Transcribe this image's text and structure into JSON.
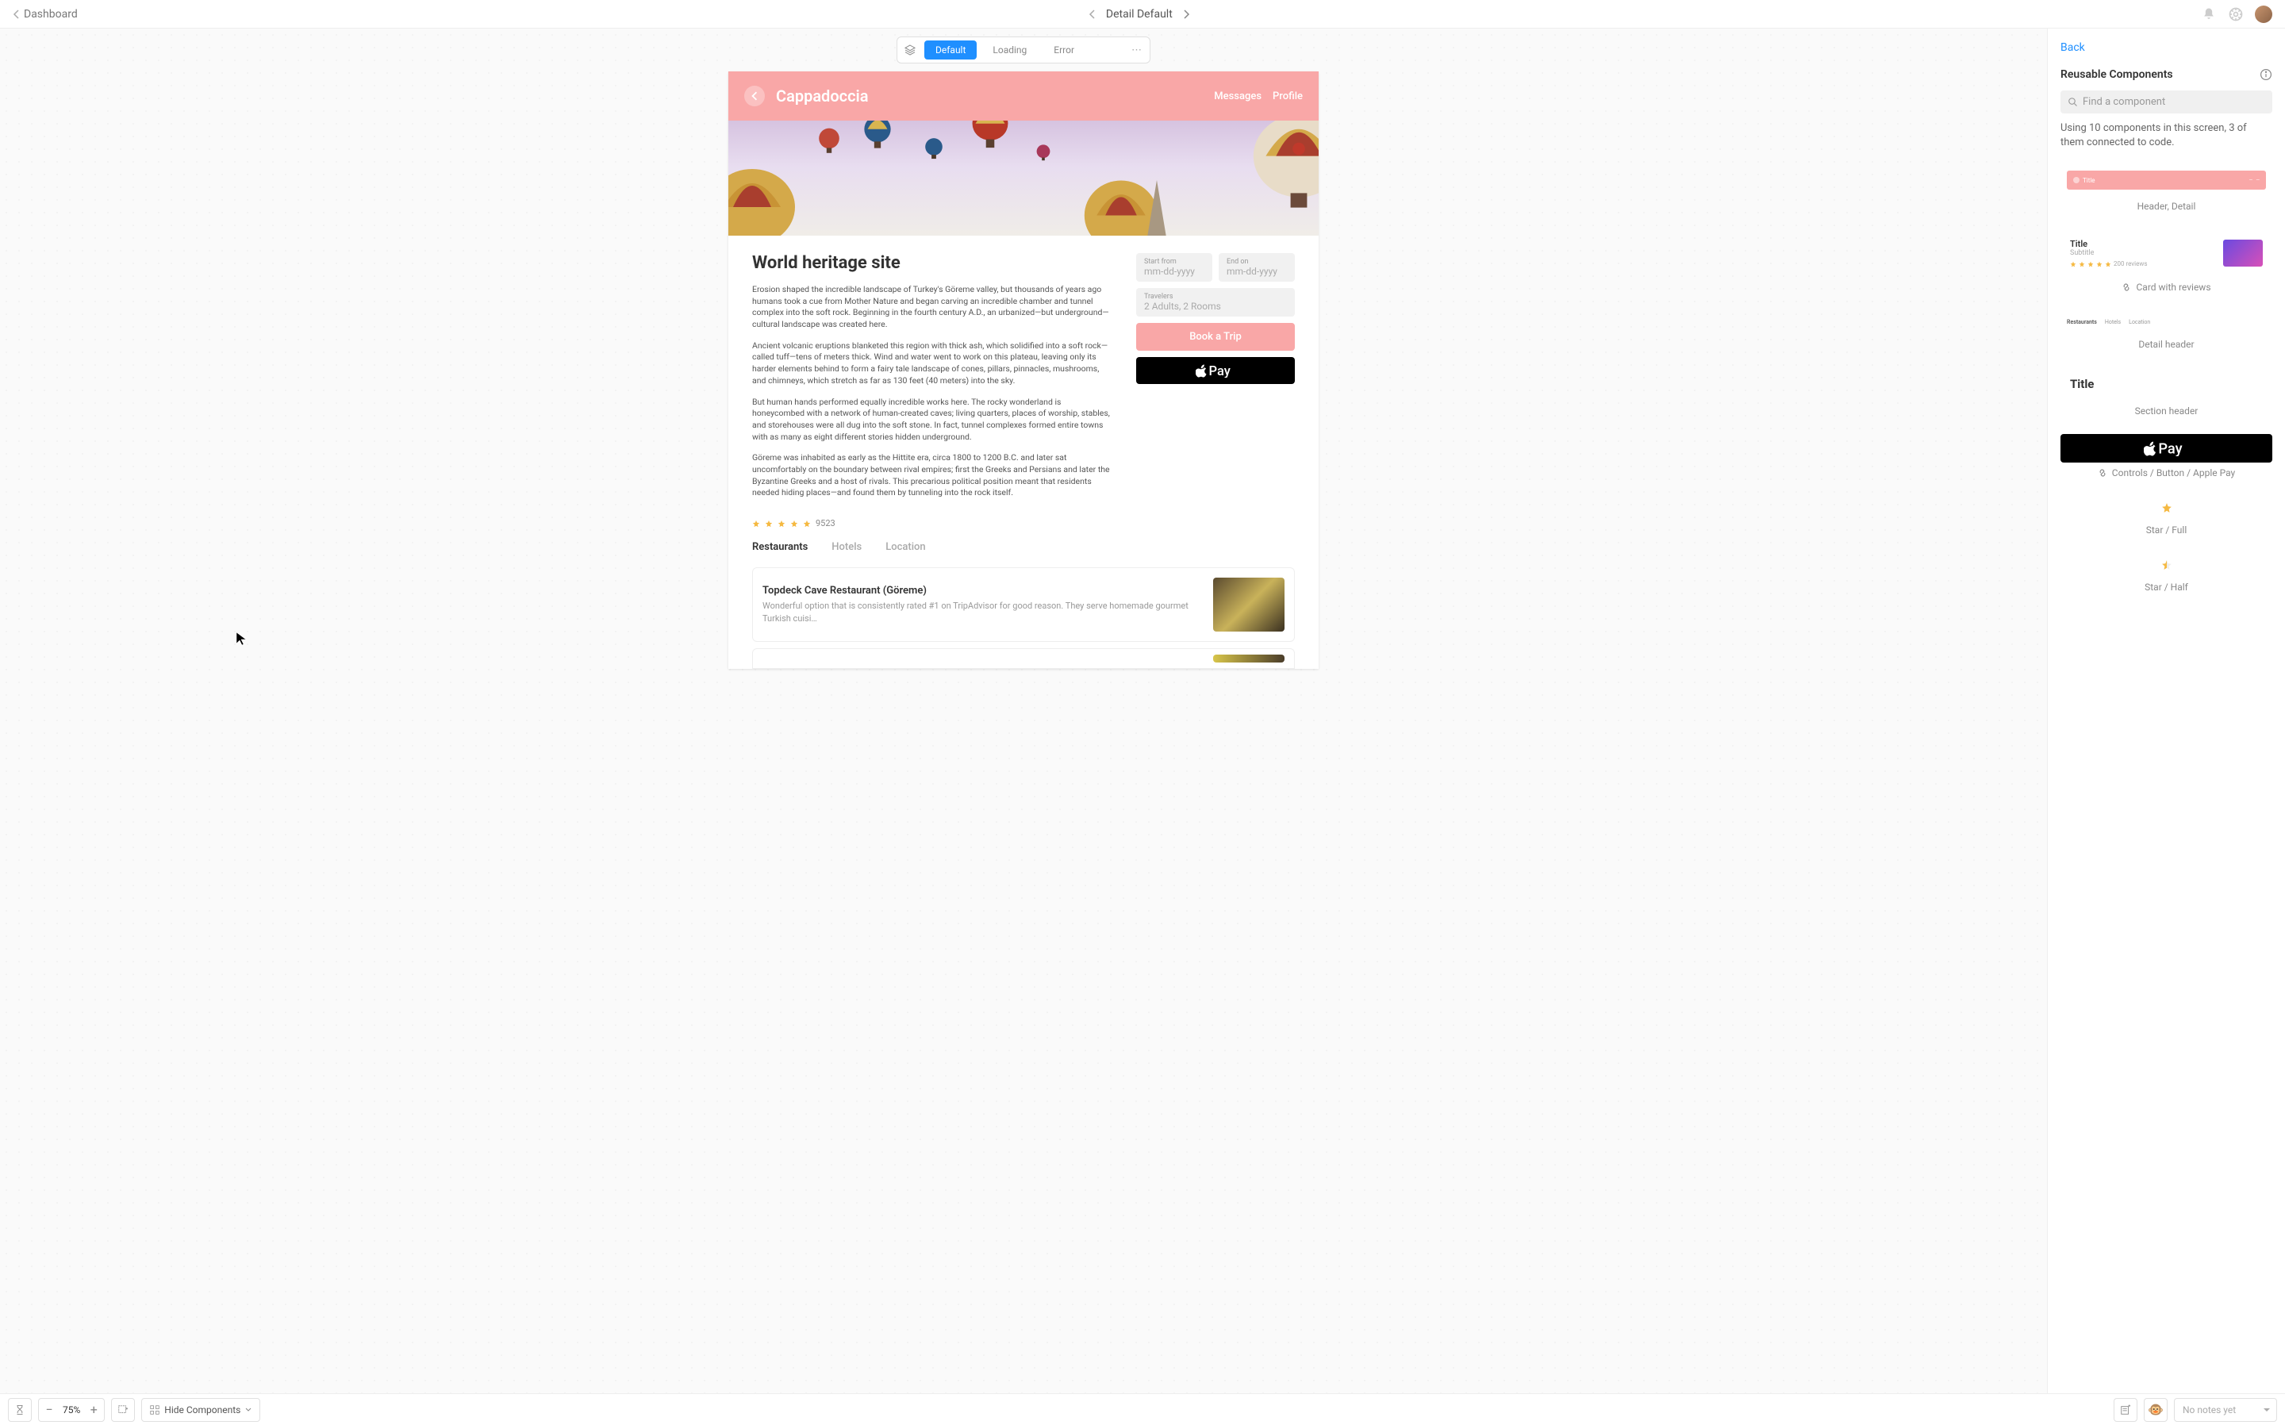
{
  "topbar": {
    "back_label": "Dashboard",
    "title": "Detail Default"
  },
  "state_switcher": {
    "tabs": [
      "Default",
      "Loading",
      "Error"
    ],
    "active_index": 0
  },
  "artboard": {
    "header": {
      "title": "Cappadoccia",
      "nav": [
        "Messages",
        "Profile"
      ]
    },
    "content": {
      "title": "World heritage site",
      "paragraphs": [
        "Erosion shaped the incredible landscape of Turkey's Göreme valley, but thousands of years ago humans took a cue from Mother Nature and began carving an incredible chamber and tunnel complex into the soft rock. Beginning in the fourth century A.D., an urbanized—but underground—cultural landscape was created here.",
        "Ancient volcanic eruptions blanketed this region with thick ash, which solidified into a soft rock—called tuff—tens of meters thick. Wind and water went to work on this plateau, leaving only its harder elements behind to form a fairy tale landscape of cones, pillars, pinnacles, mushrooms, and chimneys, which stretch as far as 130 feet (40 meters) into the sky.",
        "But human hands performed equally incredible works here. The rocky wonderland is honeycombed with a network of human-created caves; living quarters, places of worship, stables, and storehouses were all dug into the soft stone. In fact, tunnel complexes formed entire towns with as many as eight different stories hidden underground.",
        "Göreme was inhabited as early as the Hittite era, circa 1800 to 1200 B.C. and later sat uncomfortably on the boundary between rival empires; first the Greeks and Persians and later the Byzantine Greeks and a host of rivals. This precarious political position meant that residents needed hiding places—and found them by tunneling into the rock itself."
      ],
      "rating_count": "9523"
    },
    "booking": {
      "start_label": "Start from",
      "start_placeholder": "mm-dd-yyyy",
      "end_label": "End on",
      "end_placeholder": "mm-dd-yyyy",
      "travelers_label": "Travelers",
      "travelers_value": "2 Adults, 2 Rooms",
      "book_button": "Book a Trip"
    },
    "detail_tabs": {
      "items": [
        "Restaurants",
        "Hotels",
        "Location"
      ],
      "active_index": 0
    },
    "card": {
      "title": "Topdeck Cave Restaurant (Göreme)",
      "subtitle": "Wonderful option that is consistently rated #1 on TripAdvisor for good reason. They serve homemade gourmet Turkish cuisi…"
    }
  },
  "sidebar": {
    "back": "Back",
    "title": "Reusable Components",
    "search_placeholder": "Find a component",
    "hint": "Using 10 components in this screen, 3 of them connected to code.",
    "components": {
      "header_detail": {
        "title": "Title",
        "label": "Header, Detail"
      },
      "card_reviews": {
        "title": "Title",
        "subtitle": "Subtitle",
        "reviews": "200 reviews",
        "label": "Card with reviews"
      },
      "detail_header": {
        "tabs": [
          "Restaurants",
          "Hotels",
          "Location"
        ],
        "label": "Detail header"
      },
      "section_header": {
        "title": "Title",
        "label": "Section header"
      },
      "apple_pay": {
        "label": "Controls / Button / Apple Pay"
      },
      "star_full": {
        "label": "Star / Full"
      },
      "star_half": {
        "label": "Star / Half"
      }
    }
  },
  "bottombar": {
    "zoom": "75%",
    "hide_components": "Hide Components",
    "notes": "No notes yet"
  }
}
